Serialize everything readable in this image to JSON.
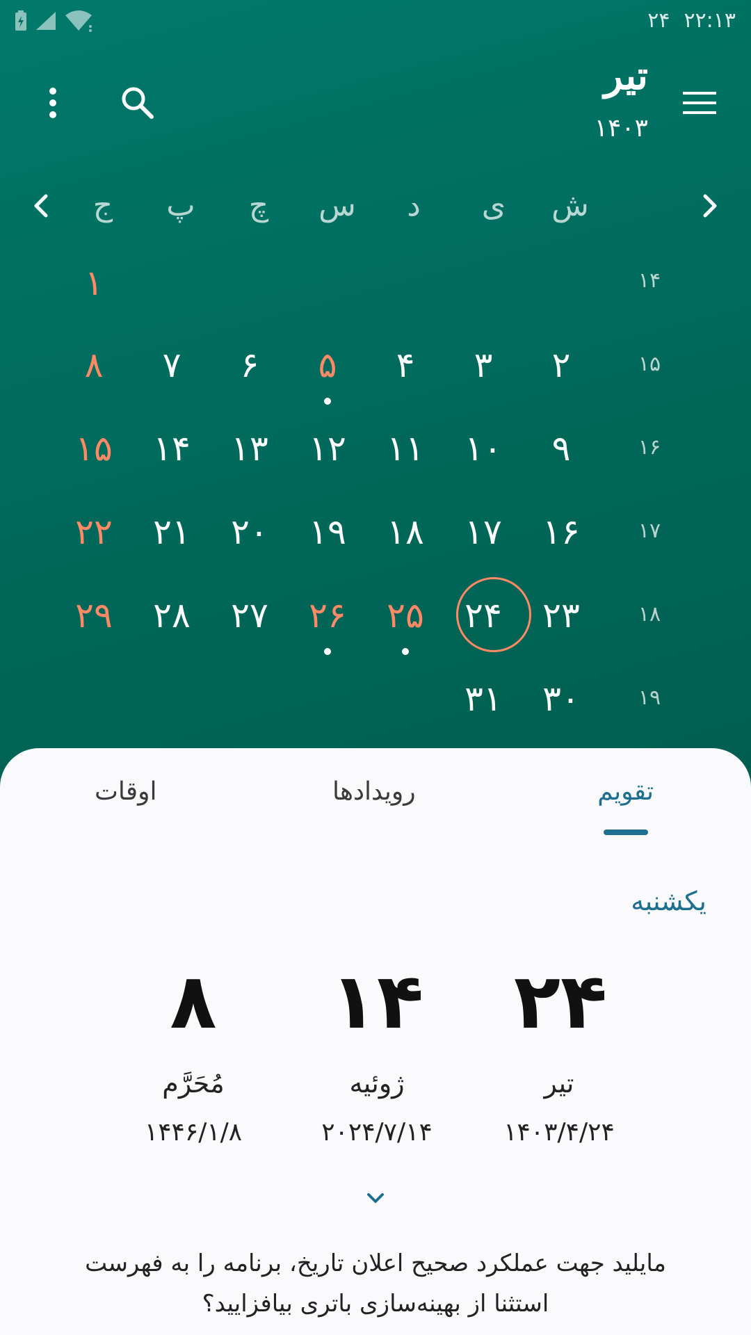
{
  "status_bar": {
    "time": "۲۲:۱۳",
    "extra": "۲۴",
    "icons": [
      "battery-charging-icon",
      "cell-signal-icon",
      "wifi-icon"
    ]
  },
  "header": {
    "month": "تیر",
    "year": "۱۴۰۳",
    "icons": [
      "menu-icon",
      "search-icon",
      "more-vert-icon"
    ]
  },
  "calendar": {
    "weekdays": [
      "ش",
      "ی",
      "د",
      "س",
      "چ",
      "پ",
      "ج"
    ],
    "weeks": [
      {
        "num": "۱۴",
        "days": [
          "",
          "",
          "",
          "",
          "",
          "",
          "۱"
        ]
      },
      {
        "num": "۱۵",
        "days": [
          "۲",
          "۳",
          "۴",
          "۵",
          "۶",
          "۷",
          "۸"
        ]
      },
      {
        "num": "۱۶",
        "days": [
          "۹",
          "۱۰",
          "۱۱",
          "۱۲",
          "۱۳",
          "۱۴",
          "۱۵"
        ]
      },
      {
        "num": "۱۷",
        "days": [
          "۱۶",
          "۱۷",
          "۱۸",
          "۱۹",
          "۲۰",
          "۲۱",
          "۲۲"
        ]
      },
      {
        "num": "۱۸",
        "days": [
          "۲۳",
          "۲۴",
          "۲۵",
          "۲۶",
          "۲۷",
          "۲۸",
          "۲۹"
        ]
      },
      {
        "num": "۱۹",
        "days": [
          "۳۰",
          "۳۱",
          "",
          "",
          "",
          "",
          ""
        ]
      }
    ],
    "holidays": [
      "۱",
      "۵",
      "۸",
      "۱۵",
      "۲۲",
      "۲۵",
      "۲۶",
      "۲۹"
    ],
    "event_dots": [
      "۵",
      "۲۵",
      "۲۶"
    ],
    "today": "۲۴",
    "colors": {
      "holiday": "#ff8a65",
      "today_ring": "#ff8a65",
      "background": "#00695c"
    }
  },
  "tabs": [
    {
      "label": "تقویم",
      "active": true
    },
    {
      "label": "رویدادها",
      "active": false
    },
    {
      "label": "اوقات",
      "active": false
    }
  ],
  "day_info": {
    "weekday": "یکشنبه",
    "persian": {
      "day": "۲۴",
      "month": "تیر",
      "date": "۱۴۰۳/۴/۲۴"
    },
    "gregorian": {
      "day": "۱۴",
      "month": "ژوئیه",
      "date": "۲۰۲۴/۷/۱۴"
    },
    "islamic": {
      "day": "۸",
      "month": "مُحَرَّم",
      "date": "۱۴۴۶/۱/۸"
    }
  },
  "notice": "مایلید جهت عملکرد صحیح اعلان تاریخ، برنامه را به فهرست استثنا از بهینه‌سازی باتری بیافزایید؟",
  "accent_color": "#1e6f8f"
}
